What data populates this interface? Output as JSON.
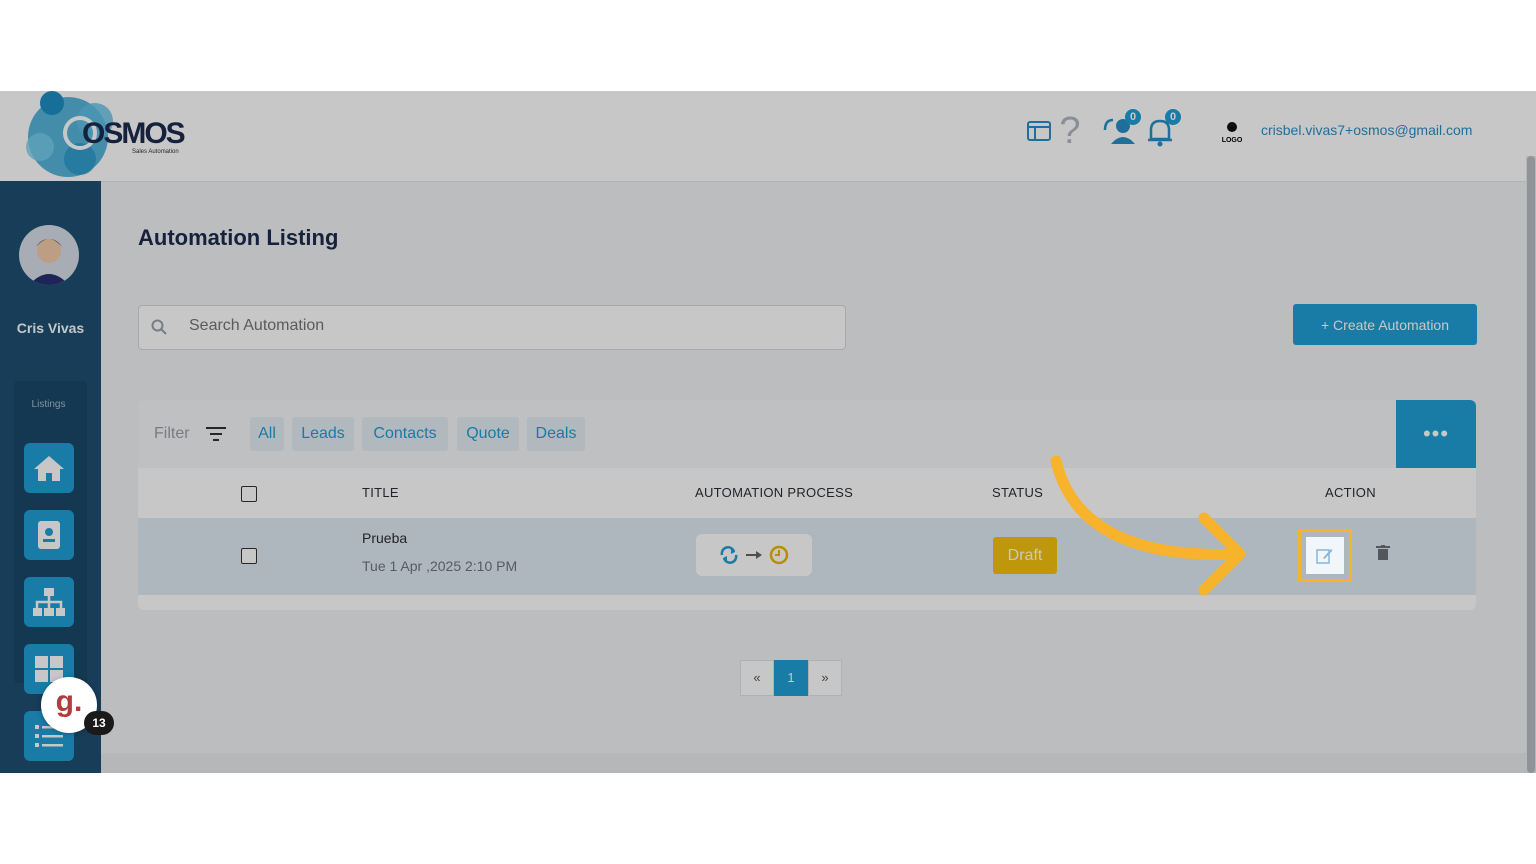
{
  "header": {
    "logo_text": "OSMOS",
    "logo_sub": "Sales Automation",
    "user_logo_text": "LOGO",
    "user_email": "crisbel.vivas7+osmos@gmail.com",
    "contacts_count": "0",
    "notifications_count": "0"
  },
  "sidebar": {
    "user_name": "Cris Vivas",
    "section_label": "Listings"
  },
  "main": {
    "title": "Automation Listing",
    "search_placeholder": "Search Automation",
    "create_label": "+ Create Automation",
    "filter_label": "Filter",
    "filter_chips": [
      "All",
      "Leads",
      "Contacts",
      "Quote",
      "Deals"
    ],
    "more_label": "•••",
    "columns": [
      "TITLE",
      "AUTOMATION PROCESS",
      "STATUS",
      "ACTION"
    ],
    "rows": [
      {
        "title": "Prueba",
        "date": "Tue 1 Apr ,2025 2:10 PM",
        "status": "Draft"
      }
    ],
    "pagination": {
      "prev": "«",
      "current": "1",
      "next": "»"
    }
  },
  "widget": {
    "label": "g.",
    "count": "13"
  },
  "colors": {
    "accent": "#1f9fd6",
    "sidebar": "#1e4f73",
    "draft": "#f4c20d",
    "highlight": "#f7b32b"
  }
}
